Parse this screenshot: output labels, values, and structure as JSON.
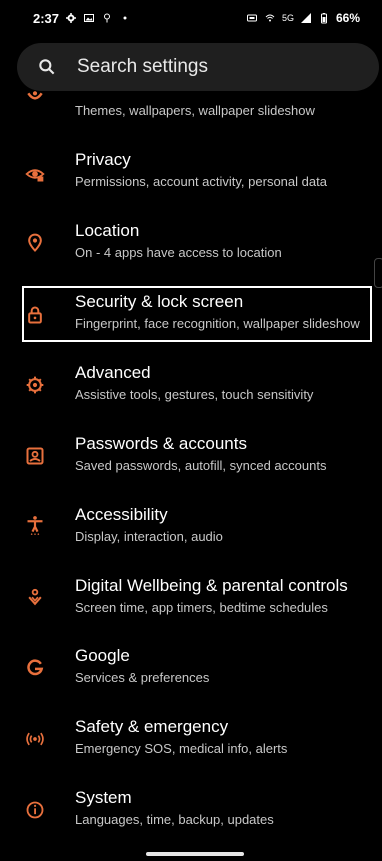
{
  "status_bar": {
    "time": "2:37",
    "network": "5G",
    "battery": "66%",
    "icons": [
      "gear-icon",
      "image-icon",
      "location-pin-icon",
      "dot-icon",
      "sim-icon",
      "wifi-icon",
      "signal-icon",
      "battery-icon"
    ]
  },
  "search": {
    "placeholder": "Search settings",
    "icon": "search-icon"
  },
  "accent_color": "#e8703d",
  "items": [
    {
      "title": "",
      "subtitle": "Themes, wallpapers, wallpaper slideshow",
      "icon": "palette-icon"
    },
    {
      "title": "Privacy",
      "subtitle": "Permissions, account activity, personal data",
      "icon": "privacy-eye-icon"
    },
    {
      "title": "Location",
      "subtitle": "On - 4 apps have access to location",
      "icon": "location-icon"
    },
    {
      "title": "Security & lock screen",
      "subtitle": "Fingerprint, face recognition, wallpaper slideshow",
      "icon": "lock-icon",
      "highlighted": true
    },
    {
      "title": "Advanced",
      "subtitle": "Assistive tools, gestures, touch sensitivity",
      "icon": "gear-icon"
    },
    {
      "title": "Passwords & accounts",
      "subtitle": "Saved passwords, autofill, synced accounts",
      "icon": "account-box-icon"
    },
    {
      "title": "Accessibility",
      "subtitle": "Display, interaction, audio",
      "icon": "accessibility-icon"
    },
    {
      "title": "Digital Wellbeing & parental controls",
      "subtitle": "Screen time, app timers, bedtime schedules",
      "icon": "wellbeing-icon"
    },
    {
      "title": "Google",
      "subtitle": "Services & preferences",
      "icon": "google-icon"
    },
    {
      "title": "Safety & emergency",
      "subtitle": "Emergency SOS, medical info, alerts",
      "icon": "emergency-icon"
    },
    {
      "title": "System",
      "subtitle": "Languages, time, backup, updates",
      "icon": "info-icon"
    }
  ]
}
